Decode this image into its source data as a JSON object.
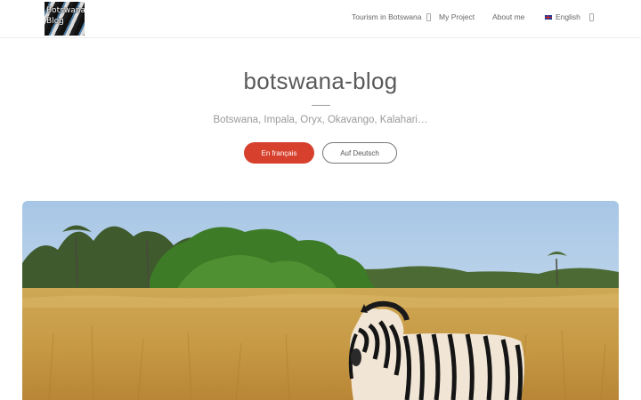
{
  "logo": {
    "line1": "Botswana",
    "line2": "Blog"
  },
  "nav": {
    "items": [
      {
        "label": "Tourism in Botswana",
        "has_dropdown": true
      },
      {
        "label": "My Project",
        "has_dropdown": false
      },
      {
        "label": "About me",
        "has_dropdown": false
      },
      {
        "label": "English",
        "has_dropdown": true,
        "icon": "uk-flag-icon"
      }
    ]
  },
  "hero": {
    "title": "botswana-blog",
    "subtitle": "Botswana, Impala, Oryx, Okavango, Kalahari…",
    "buttons": {
      "french": "En français",
      "german": "Auf Deutsch"
    }
  },
  "colors": {
    "accent": "#d6402d",
    "text": "#5b5b5b",
    "muted": "#9a9a9a"
  }
}
